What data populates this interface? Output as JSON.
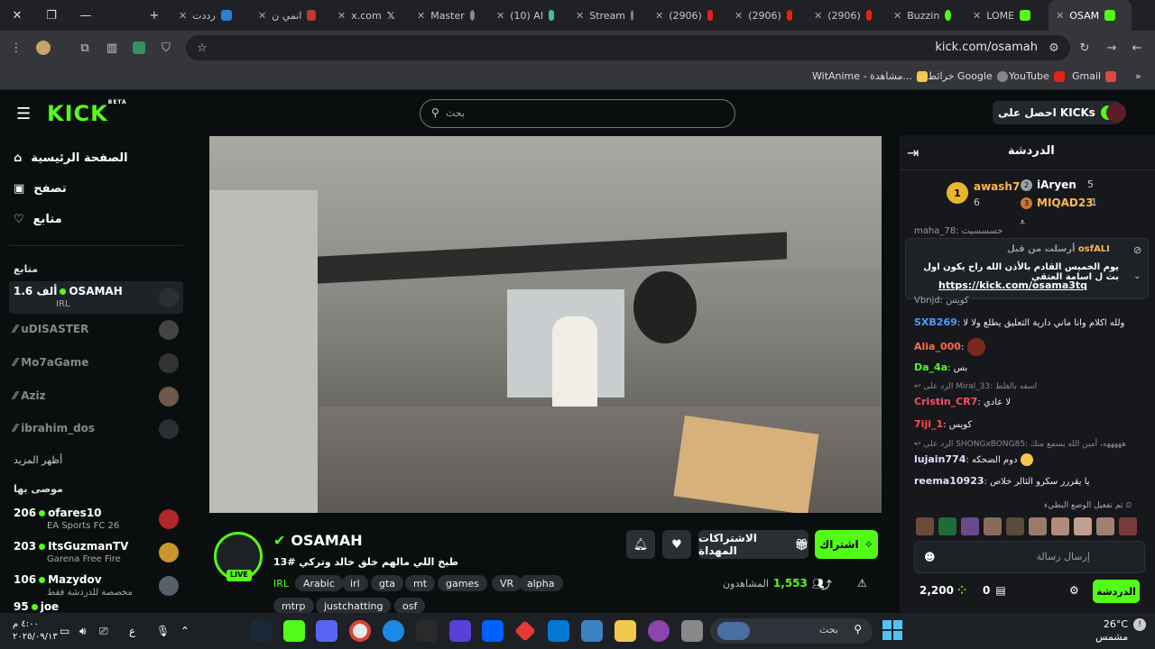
{
  "tabs": [
    {
      "label": "رددت",
      "icon": "reddit-icon"
    },
    {
      "label": "انمي ن",
      "icon": "top-icon"
    },
    {
      "label": "x.com",
      "icon": "x-icon"
    },
    {
      "label": "Master",
      "icon": "globe-icon"
    },
    {
      "label": "(10) AI",
      "icon": "chat-icon"
    },
    {
      "label": "Stream",
      "icon": "globe-icon"
    },
    {
      "label": "(2906)",
      "icon": "youtube-icon"
    },
    {
      "label": "(2906)",
      "icon": "youtube-icon"
    },
    {
      "label": "(2906)",
      "icon": "youtube-icon"
    },
    {
      "label": "Buzzin",
      "icon": "green-dot-icon"
    },
    {
      "label": "LOME",
      "icon": "kick-icon"
    },
    {
      "label": "OSAM",
      "icon": "kick-icon"
    }
  ],
  "address": {
    "url": "kick.com/osamah"
  },
  "bookmarks": [
    {
      "label": "Gmail"
    },
    {
      "label": "YouTube"
    },
    {
      "label": "خرائط Google"
    },
    {
      "label": "WitAnime - مشاهدة..."
    }
  ],
  "header": {
    "logo": "KICK",
    "beta": "BETA",
    "search_placeholder": "بحث",
    "get_kicks": "احصل على KICKs"
  },
  "sidebar": {
    "nav": [
      {
        "label": "الصفحة الرئيسية"
      },
      {
        "label": "تصفح"
      },
      {
        "label": "متابع"
      }
    ],
    "following_title": "متابع",
    "following": [
      {
        "name": "OSAMAH",
        "viewers": "1.6 ألف",
        "category": "IRL",
        "live": true
      },
      {
        "name": "uDISASTER",
        "live": false
      },
      {
        "name": "Mo7aGame",
        "live": false
      },
      {
        "name": "Aziz",
        "live": false
      },
      {
        "name": "ibrahim_dos",
        "live": false
      }
    ],
    "show_more": "أظهر المزيد",
    "recommended_title": "موصى بها",
    "recommended": [
      {
        "name": "ofares10",
        "viewers": "206",
        "category": "EA Sports FC 26"
      },
      {
        "name": "ItsGuzmanTV",
        "viewers": "203",
        "category": "Garena Free Fire"
      },
      {
        "name": "Mazydov",
        "viewers": "106",
        "category": "مخصصة للدردشة فقط"
      },
      {
        "name": "joe",
        "viewers": "95",
        "category": ""
      }
    ]
  },
  "stream": {
    "channel": "OSAMAH",
    "title": "طبخ اللي مالهم خلق خالد وتركي #13",
    "live_badge": "LIVE",
    "tags": [
      "IRL",
      "Arabic",
      "irl",
      "gta",
      "mt",
      "games",
      "VR",
      "alpha",
      "mtrp",
      "justchatting",
      "osf"
    ],
    "viewers_label": "المشاهدون",
    "viewers": "1,553",
    "subscribe": "اشتراك",
    "gift_subs": "الاشتراكات المهداة"
  },
  "chat": {
    "title": "الدردشة",
    "leaderboard": [
      {
        "rank": "1",
        "name": "awash7",
        "count": "6"
      },
      {
        "rank": "2",
        "name": "iAryen",
        "count": "5"
      },
      {
        "rank": "3",
        "name": "MIQAD23",
        "count": "1"
      }
    ],
    "pinned": {
      "by": "osfALI",
      "label": "أرسلت من قبل",
      "text": "يوم الخميس القادم بالأذن الله راح يكون اول بث ل اسامة العتقي",
      "link": "https://kick.com/osama3tq"
    },
    "partial_top": "maha_78: حسسسيت",
    "partial_2": "Vbnjd: كويس",
    "messages": [
      {
        "user": "SXB269",
        "color": "#4d9cff",
        "text": "ولله اكلام وانا ماني دارية التعليق يطلع ولا لا"
      },
      {
        "user": "Alia_000",
        "color": "#ff6a4d",
        "text": ""
      },
      {
        "user": "Da_4a",
        "color": "#53fc18",
        "text": "بس"
      },
      {
        "reply": "الرد على Miral_33: اسفه بالغلط"
      },
      {
        "user": "Cristin_CR7",
        "color": "#ff4d6a",
        "text": "لا عادي"
      },
      {
        "user": "7iji_1",
        "color": "#ff4d4d",
        "text": "كويس"
      },
      {
        "reply": "الرد على SHONGxBONG85: هههههه، أمين الله يسمع منك"
      },
      {
        "user": "lujain774",
        "color": "#e0e0ff",
        "text": "دوم الضحكه"
      },
      {
        "user": "reema10923",
        "color": "#e0e0ff",
        "text": "يا يقررر سكرو الثالر خلاص"
      }
    ],
    "slow_mode": "تم تفعيل الوضع البطيء",
    "input_placeholder": "إرسال رسالة",
    "points": "2,200",
    "subs_count": "0",
    "send": "الدردشة"
  },
  "taskbar": {
    "search": "بحث",
    "weather_temp": "26°C",
    "weather_desc": "مشمس",
    "time": "٤:٠٠ م",
    "date": "٢٠٢٥/٠٩/١٣",
    "lang": "ع"
  },
  "colors": {
    "kick_green": "#53fc18",
    "bg": "#0b0e0f",
    "chat_bg": "#16181b"
  }
}
